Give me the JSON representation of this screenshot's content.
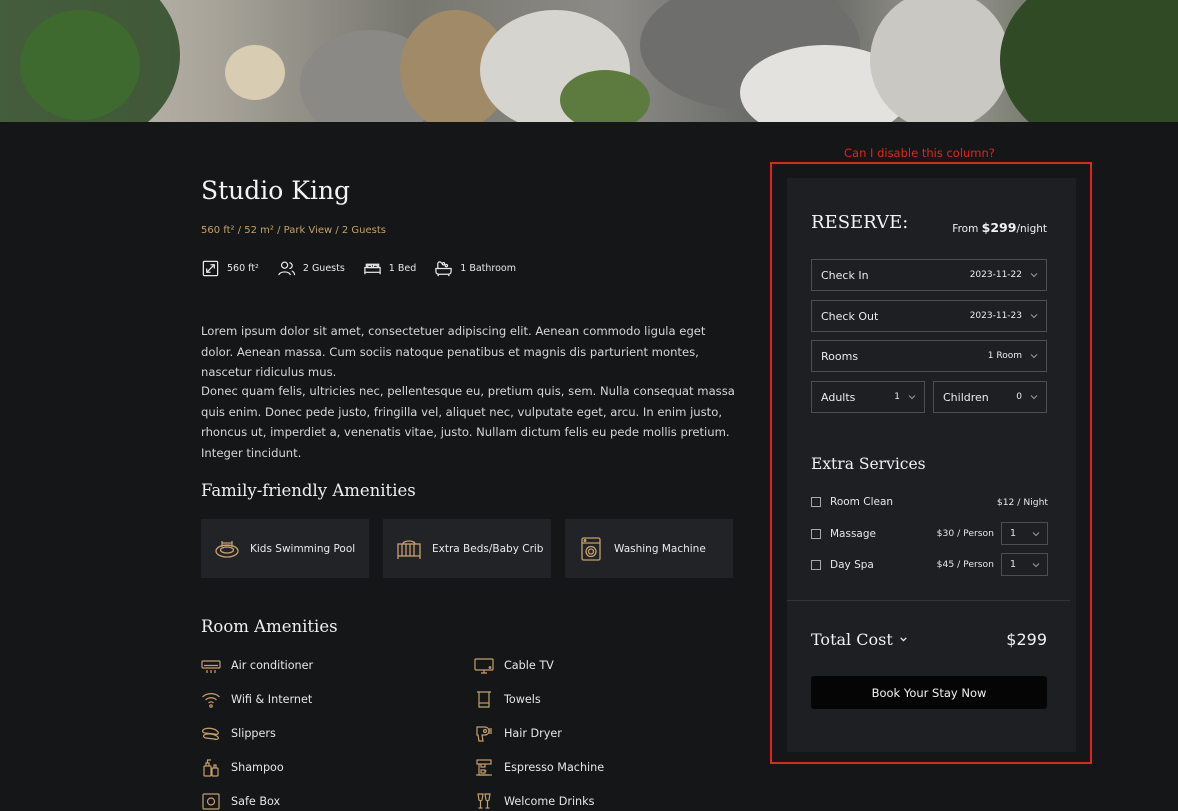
{
  "hero": {
    "image_alt": "living room with grey sofa, cushions and plants"
  },
  "room": {
    "title": "Studio King",
    "subline": "560 ft² / 52 m² / Park View / 2 Guests",
    "facts": [
      {
        "icon": "expand-icon",
        "label": "560 ft²"
      },
      {
        "icon": "guests-icon",
        "label": "2 Guests"
      },
      {
        "icon": "bed-icon",
        "label": "1 Bed"
      },
      {
        "icon": "bathtub-icon",
        "label": "1 Bathroom"
      }
    ],
    "paragraph1": "Lorem ipsum dolor sit amet, consectetuer adipiscing elit. Aenean commodo ligula eget dolor. Aenean massa. Cum sociis natoque penatibus et magnis dis parturient montes, nascetur ridiculus mus.",
    "paragraph2": "Donec quam felis, ultricies nec, pellentesque eu, pretium quis, sem. Nulla consequat massa quis enim. Donec pede justo, fringilla vel, aliquet nec, vulputate eget, arcu. In enim justo, rhoncus ut, imperdiet a, venenatis vitae, justo. Nullam dictum felis eu pede mollis pretium. Integer tincidunt."
  },
  "family_amenities": {
    "heading": "Family-friendly Amenities",
    "items": [
      {
        "icon": "pool-icon",
        "label": "Kids Swimming Pool"
      },
      {
        "icon": "crib-icon",
        "label": "Extra Beds/Baby Crib"
      },
      {
        "icon": "washing-machine-icon",
        "label": "Washing Machine"
      }
    ]
  },
  "room_amenities": {
    "heading": "Room Amenities",
    "left": [
      {
        "icon": "air-conditioner-icon",
        "label": "Air conditioner"
      },
      {
        "icon": "wifi-icon",
        "label": "Wifi & Internet"
      },
      {
        "icon": "slippers-icon",
        "label": "Slippers"
      },
      {
        "icon": "shampoo-icon",
        "label": "Shampoo"
      },
      {
        "icon": "safe-box-icon",
        "label": "Safe Box"
      }
    ],
    "right": [
      {
        "icon": "tv-icon",
        "label": "Cable TV"
      },
      {
        "icon": "towel-icon",
        "label": "Towels"
      },
      {
        "icon": "hair-dryer-icon",
        "label": "Hair Dryer"
      },
      {
        "icon": "espresso-machine-icon",
        "label": "Espresso Machine"
      },
      {
        "icon": "drinks-icon",
        "label": "Welcome Drinks"
      }
    ]
  },
  "annotation": {
    "text": "Can I disable this column?",
    "color": "#e0261b"
  },
  "reserve": {
    "title": "RESERVE:",
    "from_prefix": "From ",
    "price": "$299",
    "per": "/night",
    "check_in": {
      "label": "Check In",
      "value": "2023-11-22"
    },
    "check_out": {
      "label": "Check Out",
      "value": "2023-11-23"
    },
    "rooms": {
      "label": "Rooms",
      "value": "1 Room"
    },
    "adults": {
      "label": "Adults",
      "value": "1"
    },
    "children": {
      "label": "Children",
      "value": "0"
    },
    "extra_title": "Extra Services",
    "services": [
      {
        "name": "Room Clean",
        "price": "$12 / Night",
        "qty": null
      },
      {
        "name": "Massage",
        "price": "$30 / Person",
        "qty": "1"
      },
      {
        "name": "Day Spa",
        "price": "$45 / Person",
        "qty": "1"
      }
    ],
    "total_label": "Total Cost",
    "total_value": "$299",
    "book_label": "Book Your Stay Now"
  },
  "colors": {
    "background": "#151618",
    "panel": "#1e1f22",
    "accent_gold": "#c5a06a"
  }
}
